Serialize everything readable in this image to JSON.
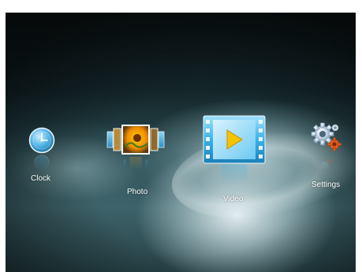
{
  "menu": {
    "items": [
      {
        "label": "Clock",
        "icon": "clock-icon"
      },
      {
        "label": "Photo",
        "icon": "photo-icon"
      },
      {
        "label": "Video",
        "icon": "video-icon"
      },
      {
        "label": "Settings",
        "icon": "settings-icon"
      }
    ],
    "selected": "Video"
  },
  "colors": {
    "accent": "#2aa7e0",
    "background_dark": "#0c1416",
    "background_light": "#dce9eb",
    "text": "#ffffff"
  }
}
